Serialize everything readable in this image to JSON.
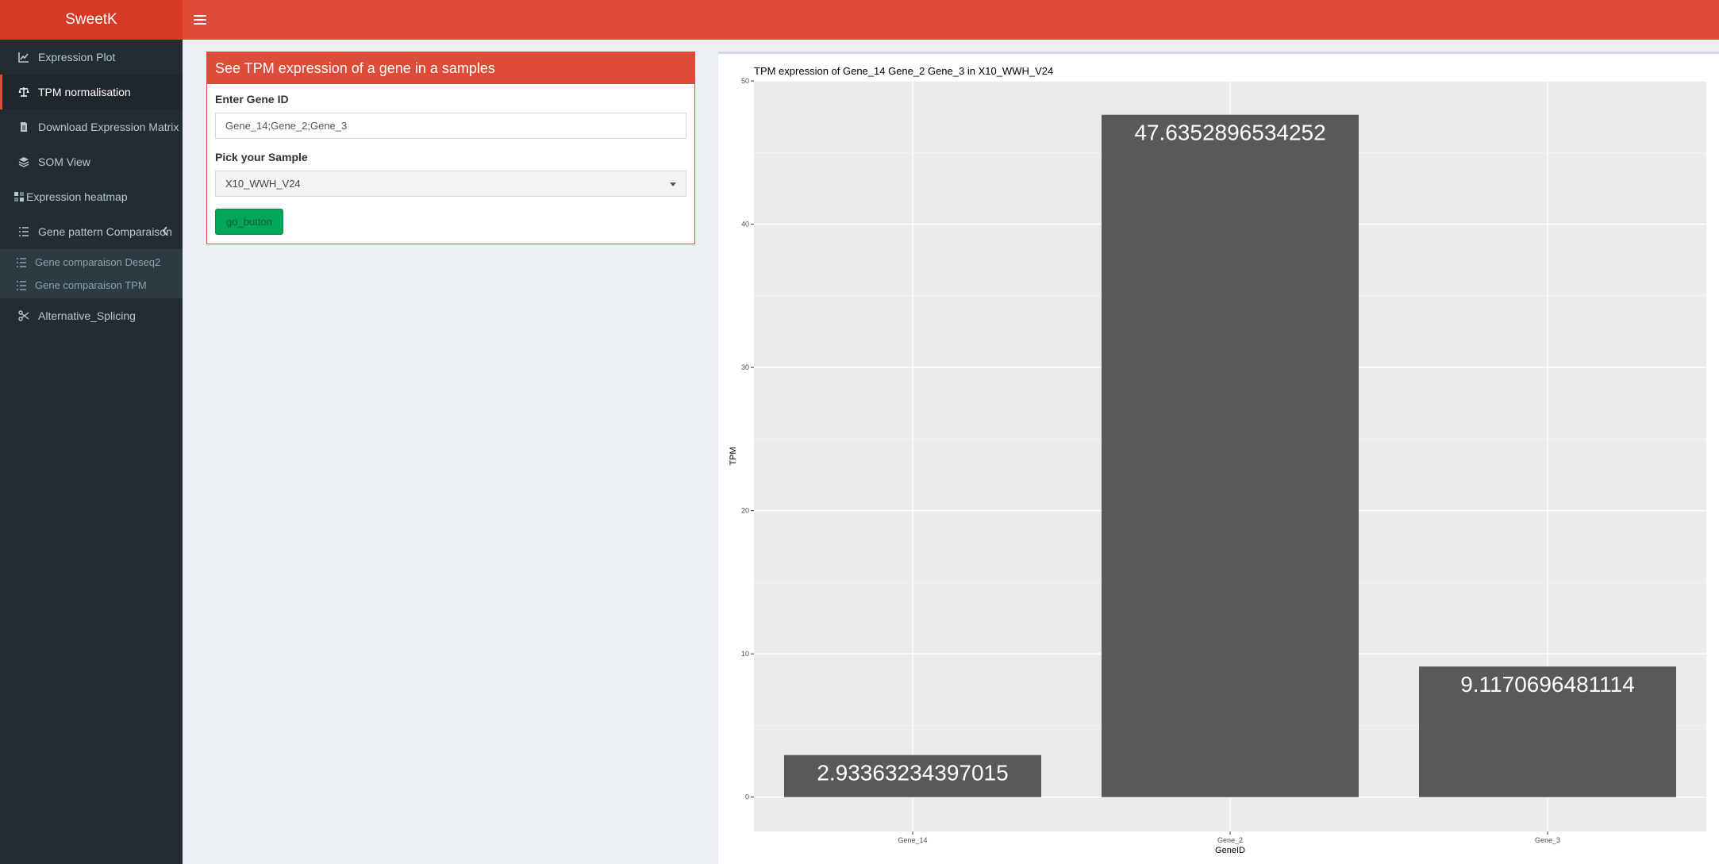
{
  "app": {
    "title": "SweetK"
  },
  "sidebar": {
    "items": [
      {
        "label": "Expression Plot",
        "icon": "line-chart-icon"
      },
      {
        "label": "TPM normalisation",
        "icon": "balance-scale-icon",
        "active": true
      },
      {
        "label": "Download Expression Matrix",
        "icon": "file-icon"
      },
      {
        "label": "SOM View",
        "icon": "layers-icon"
      },
      {
        "label": "Expression heatmap",
        "icon": "heatmap-icon"
      },
      {
        "label": "Gene pattern Comparaison",
        "icon": "list-icon",
        "expanded": true
      },
      {
        "label": "Alternative_Splicing",
        "icon": "scissors-icon"
      }
    ],
    "subitems": [
      {
        "label": "Gene comparaison Deseq2",
        "icon": "list-icon"
      },
      {
        "label": "Gene comparaison TPM",
        "icon": "list-icon"
      }
    ]
  },
  "form": {
    "box_title": "See TPM expression of a gene in a samples",
    "gene_label": "Enter Gene ID",
    "gene_value": "Gene_14;Gene_2;Gene_3",
    "sample_label": "Pick your Sample",
    "sample_value": "X10_WWH_V24",
    "button_label": "go_button"
  },
  "colors": {
    "header": "#dd4b39",
    "logo": "#d73925",
    "sidebar": "#222d32",
    "bar": "#595959",
    "plot_bg": "#ebebeb",
    "button": "#00a65a"
  },
  "chart_data": {
    "type": "bar",
    "title": "TPM expression of  Gene_14 Gene_2 Gene_3  in X10_WWH_V24",
    "xlabel": "GeneID",
    "ylabel": "TPM",
    "categories": [
      "Gene_14",
      "Gene_2",
      "Gene_3"
    ],
    "values": [
      2.93363234397015,
      47.6352896534252,
      9.1170696481114
    ],
    "data_labels": [
      "2.93363234397015",
      "47.6352896534252",
      "9.1170696481114"
    ],
    "ylim": [
      -2.4,
      50
    ],
    "yticks": [
      0,
      10,
      20,
      30,
      40,
      50
    ],
    "grid": true,
    "legend": "none"
  }
}
